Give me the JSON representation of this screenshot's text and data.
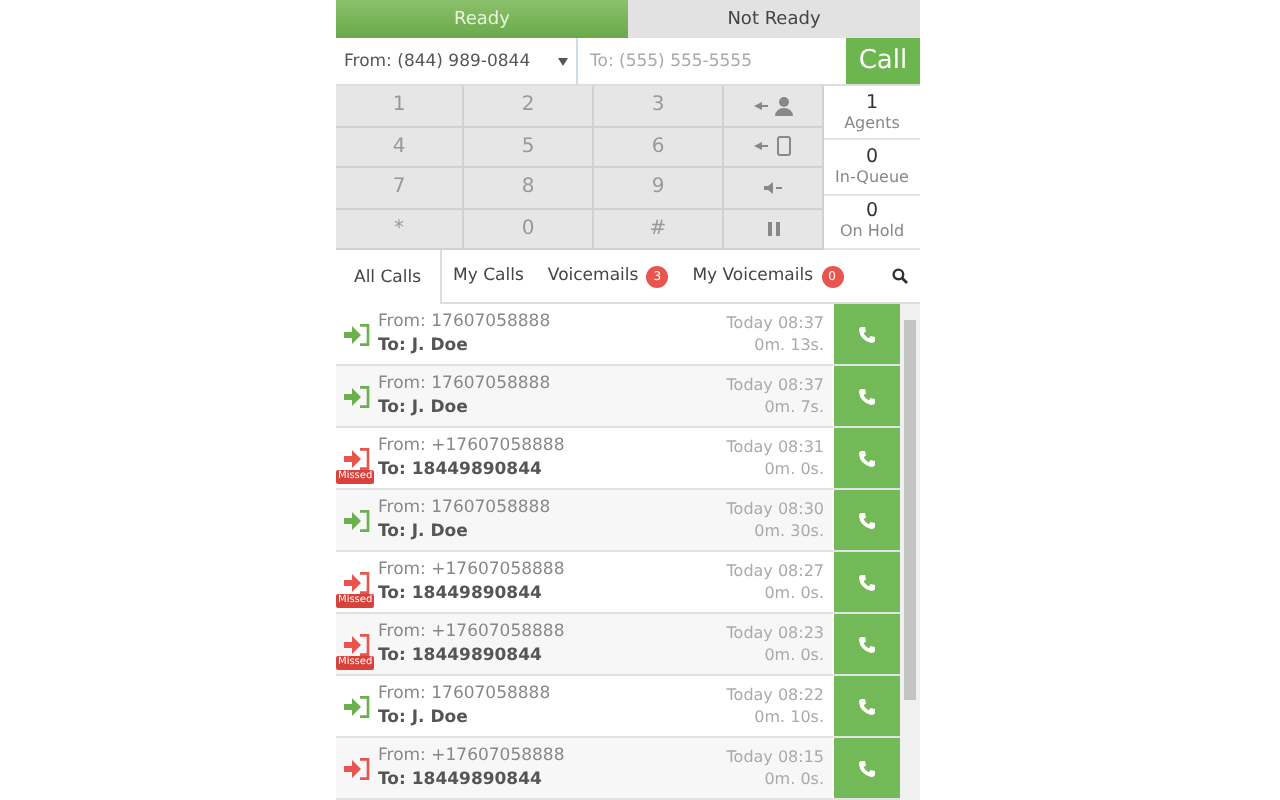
{
  "status_tabs": [
    {
      "label": "Ready",
      "selected": true
    },
    {
      "label": "Not Ready",
      "selected": false
    }
  ],
  "dialer": {
    "from": "From: (844) 989-0844",
    "to_placeholder": "To: (555) 555-5555",
    "call_button": "Call"
  },
  "keypad": [
    [
      "1",
      "2",
      "3"
    ],
    [
      "4",
      "5",
      "6"
    ],
    [
      "7",
      "8",
      "9"
    ],
    [
      "*",
      "0",
      "#"
    ]
  ],
  "actions": [
    {
      "kind": "transfer-agent"
    },
    {
      "kind": "transfer-phone"
    },
    {
      "kind": "mute"
    },
    {
      "kind": "hold"
    }
  ],
  "stats": [
    {
      "value": "1",
      "label": "Agents"
    },
    {
      "value": "0",
      "label": "In-Queue"
    },
    {
      "value": "0",
      "label": "On Hold"
    }
  ],
  "tabs": [
    {
      "label": "All Calls",
      "selected": true
    },
    {
      "label": "My Calls",
      "selected": false
    },
    {
      "label": "Voicemails",
      "selected": false,
      "badge": "3"
    },
    {
      "label": "My Voicemails",
      "selected": false,
      "badge": "0"
    }
  ],
  "calls": [
    {
      "kind": "answered",
      "from": "From: 17607058888",
      "to": "To: J. Doe",
      "time": "Today 08:37",
      "duration": "0m. 13s."
    },
    {
      "kind": "answered",
      "from": "From: 17607058888",
      "to": "To: J. Doe",
      "time": "Today 08:37",
      "duration": "0m. 7s."
    },
    {
      "kind": "missed",
      "badge": "Missed",
      "from": "From: +17607058888",
      "to": "To: 18449890844",
      "time": "Today 08:31",
      "duration": "0m. 0s."
    },
    {
      "kind": "answered",
      "from": "From: 17607058888",
      "to": "To: J. Doe",
      "time": "Today 08:30",
      "duration": "0m. 30s."
    },
    {
      "kind": "missed",
      "badge": "Missed",
      "from": "From: +17607058888",
      "to": "To: 18449890844",
      "time": "Today 08:27",
      "duration": "0m. 0s."
    },
    {
      "kind": "missed",
      "badge": "Missed",
      "from": "From: +17607058888",
      "to": "To: 18449890844",
      "time": "Today 08:23",
      "duration": "0m. 0s."
    },
    {
      "kind": "answered",
      "from": "From: 17607058888",
      "to": "To: J. Doe",
      "time": "Today 08:22",
      "duration": "0m. 10s."
    },
    {
      "kind": "missed",
      "from": "From: +17607058888",
      "to": "To: 18449890844",
      "time": "Today 08:15",
      "duration": "0m. 0s."
    }
  ]
}
